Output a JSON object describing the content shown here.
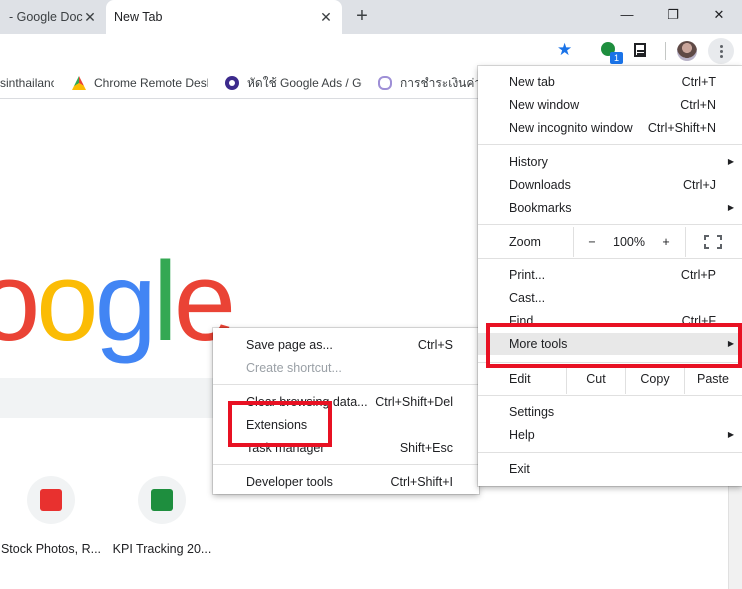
{
  "tabs": [
    {
      "title": "- Google Doc",
      "close": "✕"
    },
    {
      "title": "New Tab",
      "close": "✕"
    }
  ],
  "new_tab_button": "+",
  "window_controls": {
    "minimize": "—",
    "restore": "❐",
    "close": "✕"
  },
  "toolbar": {
    "extension_badge": "1"
  },
  "bookmarks": [
    {
      "label": "sinthailanc"
    },
    {
      "label": "Chrome Remote Desl"
    },
    {
      "label": "หัดใช้ Google Ads / Gc"
    },
    {
      "label": "การชำระเงินค่าบ"
    }
  ],
  "page": {
    "logo_letters": [
      {
        "ch": "o",
        "color": "#ea4335"
      },
      {
        "ch": "o",
        "color": "#fbbc05"
      },
      {
        "ch": "g",
        "color": "#4285f4"
      },
      {
        "ch": "l",
        "color": "#34a853"
      },
      {
        "ch": "e",
        "color": "#ea4335"
      }
    ],
    "shortcuts": [
      {
        "label": "Stock Photos, R...",
        "color": "#e8312f"
      },
      {
        "label": "KPI Tracking 20...",
        "color": "#1e8e3e"
      }
    ]
  },
  "main_menu": {
    "new_tab": {
      "label": "New tab",
      "shortcut": "Ctrl+T"
    },
    "new_window": {
      "label": "New window",
      "shortcut": "Ctrl+N"
    },
    "new_incognito": {
      "label": "New incognito window",
      "shortcut": "Ctrl+Shift+N"
    },
    "history": {
      "label": "History"
    },
    "downloads": {
      "label": "Downloads",
      "shortcut": "Ctrl+J"
    },
    "bookmarks": {
      "label": "Bookmarks"
    },
    "zoom": {
      "label": "Zoom",
      "minus": "−",
      "level": "100%",
      "plus": "+"
    },
    "print": {
      "label": "Print...",
      "shortcut": "Ctrl+P"
    },
    "cast": {
      "label": "Cast..."
    },
    "find": {
      "label": "Find...",
      "shortcut": "Ctrl+F"
    },
    "more_tools": {
      "label": "More tools"
    },
    "edit": {
      "label": "Edit",
      "cut": "Cut",
      "copy": "Copy",
      "paste": "Paste"
    },
    "settings": {
      "label": "Settings"
    },
    "help": {
      "label": "Help"
    },
    "exit": {
      "label": "Exit"
    }
  },
  "sub_menu": {
    "save_page": {
      "label": "Save page as...",
      "shortcut": "Ctrl+S"
    },
    "create_shortcut": {
      "label": "Create shortcut..."
    },
    "clear_browsing": {
      "label": "Clear browsing data...",
      "shortcut": "Ctrl+Shift+Del"
    },
    "extensions": {
      "label": "Extensions"
    },
    "task_manager": {
      "label": "Task manager",
      "shortcut": "Shift+Esc"
    },
    "developer_tools": {
      "label": "Developer tools",
      "shortcut": "Ctrl+Shift+I"
    }
  },
  "colors": {
    "highlight": "#e81123",
    "accent": "#1a73e8"
  }
}
